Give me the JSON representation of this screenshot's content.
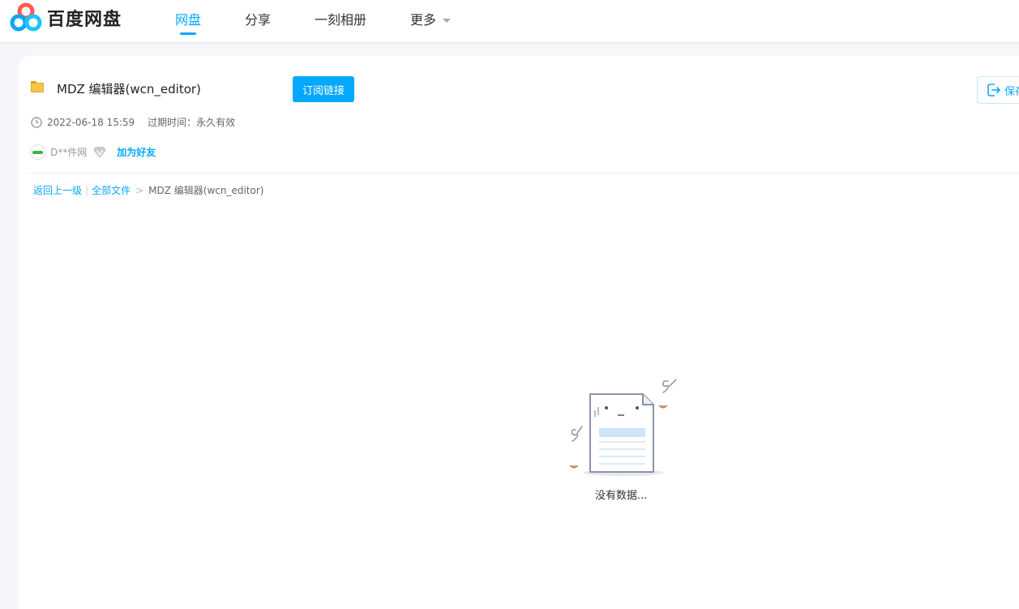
{
  "header": {
    "brand": "百度网盘",
    "nav": [
      {
        "label": "网盘",
        "active": true
      },
      {
        "label": "分享",
        "active": false
      },
      {
        "label": "一刻相册",
        "active": false
      },
      {
        "label": "更多",
        "active": false
      }
    ]
  },
  "share": {
    "title": "MDZ 编辑器(wcn_editor)",
    "subscribe_label": "订阅链接",
    "save_label": "保存",
    "date": "2022-06-18 15:59",
    "expire": "过期时间：永久有效",
    "owner": "D**件网",
    "add_friend": "加为好友"
  },
  "breadcrumb": {
    "back": "返回上一级",
    "sep": "|",
    "all_files": "全部文件",
    "arrow": ">",
    "current": "MDZ 编辑器(wcn_editor)"
  },
  "empty": {
    "text": "没有数据..."
  },
  "colors": {
    "accent": "#06a7ff",
    "folder": "#f7c447"
  }
}
